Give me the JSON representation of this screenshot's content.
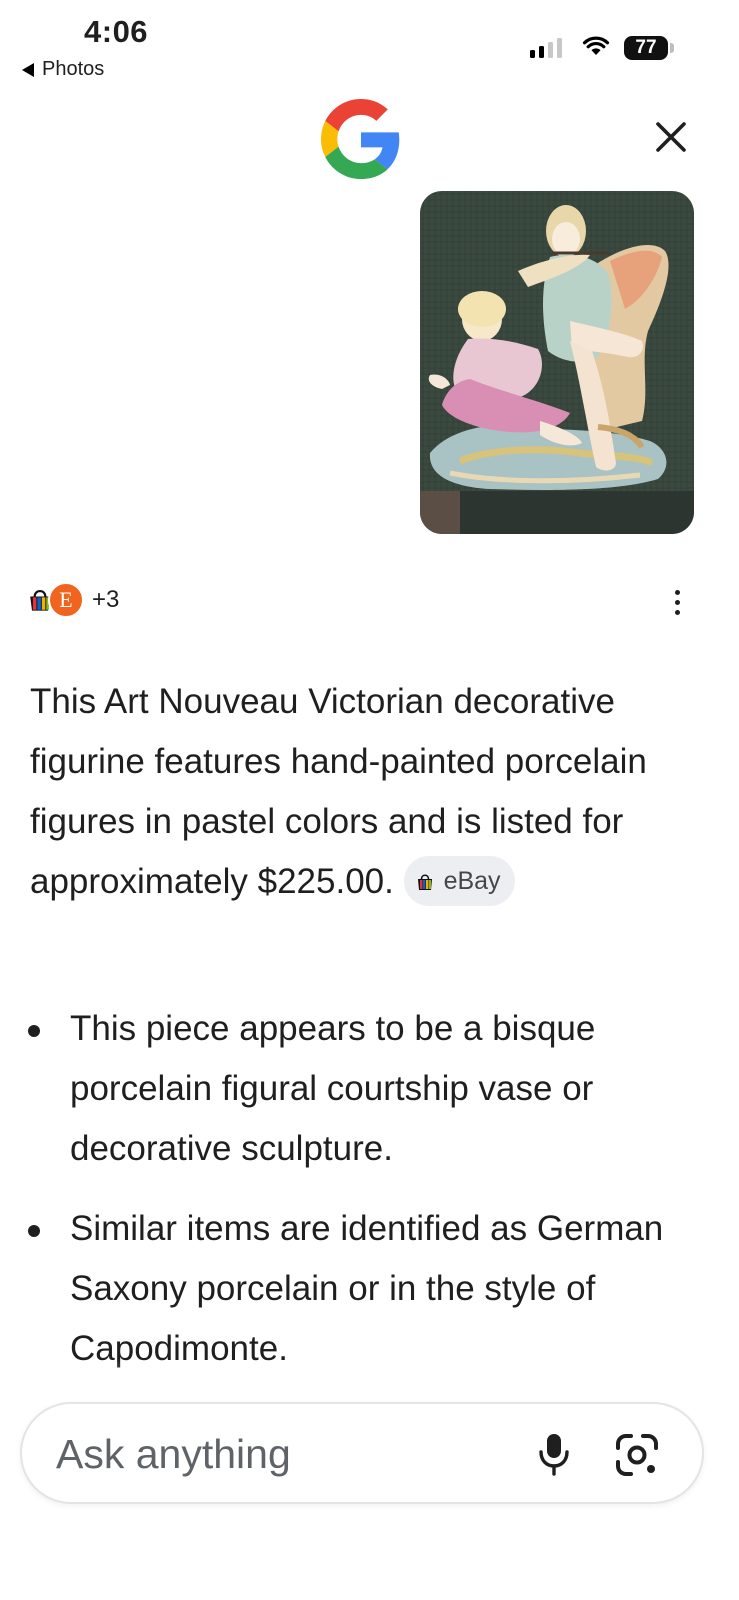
{
  "status_bar": {
    "time": "4:06",
    "back_label": "Photos",
    "battery_level": "77"
  },
  "header": {
    "logo_icon": "google-g-icon",
    "close_icon": "close-icon"
  },
  "sources": {
    "icons": [
      "ebay-icon",
      "etsy-icon"
    ],
    "etsy_letter": "E",
    "more_count": "+3"
  },
  "answer": {
    "paragraph": "This Art Nouveau Victorian decorative figurine features hand-painted porcelain figures in pastel colors and is listed for approximately $225.00.",
    "source_chip": "eBay",
    "bullets": [
      "This piece appears to be a bisque porcelain figural courtship vase or decorative sculpture.",
      "Similar items are identified as German Saxony porcelain or in the style of Capodimonte."
    ]
  },
  "input": {
    "placeholder": "Ask anything",
    "mic_icon": "microphone-icon",
    "lens_icon": "lens-camera-icon"
  },
  "colors": {
    "google_blue": "#4285F4",
    "google_red": "#EA4335",
    "google_yellow": "#FBBC05",
    "google_green": "#34A853",
    "etsy_orange": "#F1641E",
    "chip_bg": "#ECEEF2"
  }
}
